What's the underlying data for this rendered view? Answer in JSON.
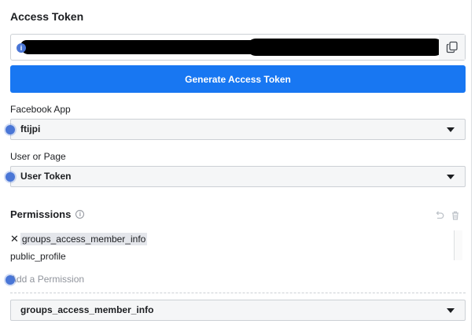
{
  "panel": {
    "title": "Access Token"
  },
  "token": {
    "info_icon": "i",
    "copy_icon": "copy-icon"
  },
  "generate_button": {
    "label": "Generate Access Token"
  },
  "facebook_app": {
    "label": "Facebook App",
    "value": "ftijpi"
  },
  "user_or_page": {
    "label": "User or Page",
    "value": "User Token"
  },
  "permissions": {
    "title": "Permissions",
    "info_icon": "i",
    "items": [
      {
        "label": "groups_access_member_info",
        "remove": "✕"
      },
      {
        "label": "public_profile"
      }
    ],
    "add_placeholder": "Add a Permission",
    "dropdown_value": "groups_access_member_info"
  },
  "colors": {
    "primary": "#1877f2",
    "indicator": "#4a76d6",
    "border": "#ccd0d5",
    "field_bg": "#f5f6f7"
  }
}
